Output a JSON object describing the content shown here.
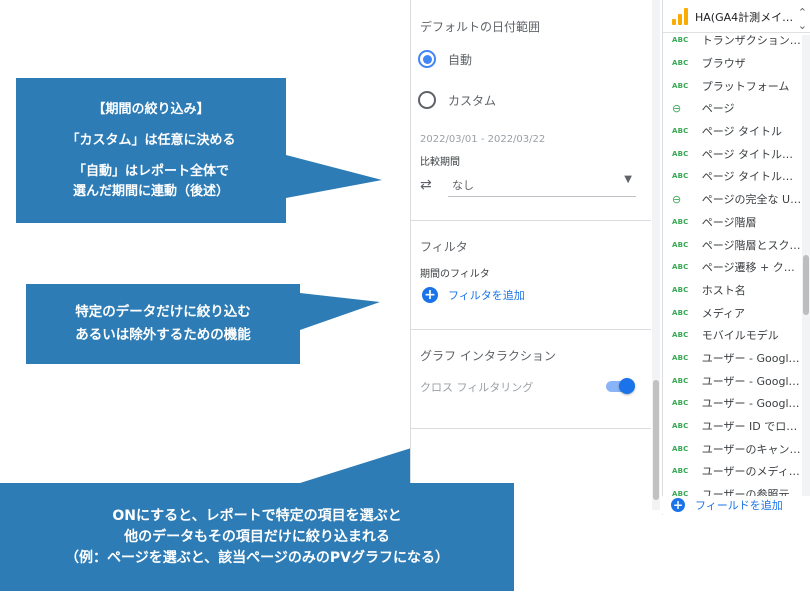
{
  "settings_panel": {
    "default_date_range": {
      "title": "デフォルトの日付範囲",
      "auto_label": "自動",
      "custom_label": "カスタム",
      "selected": "自動",
      "date_range_text": "2022/03/01 - 2022/03/22",
      "compare_label": "比較期間",
      "compare_value": "なし"
    },
    "filter": {
      "title": "フィルタ",
      "sub_label": "期間のフィルタ",
      "add_label": "フィルタを追加"
    },
    "graph_interaction": {
      "title": "グラフ インタラクション",
      "cross_filter_label": "クロス フィルタリング",
      "cross_filter_on": true
    }
  },
  "fields_panel": {
    "datasource_name": "HA(GA4計測メイ…",
    "add_field_label": "フィールドを追加",
    "fields": [
      {
        "type": "text",
        "label": "トランザクション…"
      },
      {
        "type": "text",
        "label": "ブラウザ"
      },
      {
        "type": "text",
        "label": "プラットフォーム"
      },
      {
        "type": "link",
        "label": "ページ"
      },
      {
        "type": "text",
        "label": "ページ タイトル"
      },
      {
        "type": "text",
        "label": "ページ タイトル…"
      },
      {
        "type": "text",
        "label": "ページ タイトル…"
      },
      {
        "type": "link",
        "label": "ページの完全な U…"
      },
      {
        "type": "text",
        "label": "ページ階層"
      },
      {
        "type": "text",
        "label": "ページ階層とスク…"
      },
      {
        "type": "text",
        "label": "ページ遷移 + クエ…"
      },
      {
        "type": "text",
        "label": "ホスト名"
      },
      {
        "type": "text",
        "label": "メディア"
      },
      {
        "type": "text",
        "label": "モバイルモデル"
      },
      {
        "type": "text",
        "label": "ユーザー - Google …"
      },
      {
        "type": "text",
        "label": "ユーザー - Google …"
      },
      {
        "type": "text",
        "label": "ユーザー - Google …"
      },
      {
        "type": "text",
        "label": "ユーザー ID でロ…"
      },
      {
        "type": "text",
        "label": "ユーザーのキャン…"
      },
      {
        "type": "text",
        "label": "ユーザーのメディ…"
      },
      {
        "type": "text",
        "label": "ユーザーの参照元…"
      }
    ],
    "abc_text": "ABC",
    "link_icon": "link-icon"
  },
  "callouts": {
    "period": {
      "title": "【期間の絞り込み】",
      "line1": "「カスタム」は任意に決める",
      "line2": "「自動」はレポート全体で",
      "line3": "選んだ期間に連動（後述）"
    },
    "filter": {
      "line1": "特定のデータだけに絞り込む",
      "line2": "あるいは除外するための機能"
    },
    "interaction": {
      "line1": "ONにすると、レポートで特定の項目を選ぶと",
      "line2": "他のデータもその項目だけに絞り込まれる",
      "line3": "（例：ページを選ぶと、該当ページのみのPVグラフになる）"
    }
  },
  "colors": {
    "callout": "#2d7cb5",
    "accent": "#1a73e8",
    "abc_green": "#34a853"
  }
}
